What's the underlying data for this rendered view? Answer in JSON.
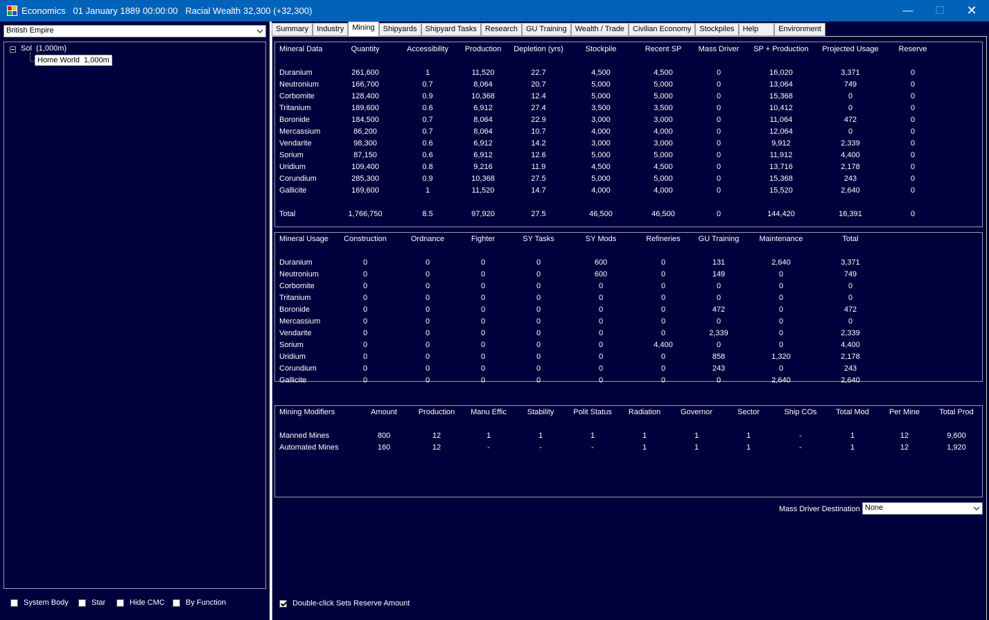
{
  "window": {
    "title": "Economics   01 January 1889 00:00:00   Racial Wealth 32,300 (+32,300)"
  },
  "sidebar": {
    "empire_select": "British Empire",
    "tree": {
      "root": "Sol  (1,000m)",
      "child": "Home World  1,000m"
    },
    "checkboxes": [
      {
        "label": "System Body",
        "checked": false
      },
      {
        "label": "Star",
        "checked": false
      },
      {
        "label": "Hide CMC",
        "checked": false
      },
      {
        "label": "By Function",
        "checked": false
      }
    ]
  },
  "tabs": [
    "Summary",
    "Industry",
    "Mining",
    "Shipyards",
    "Shipyard Tasks",
    "Research",
    "GU Training",
    "Wealth / Trade",
    "Civilian Economy",
    "Stockpiles",
    "Help",
    "Environment"
  ],
  "active_tab": "Mining",
  "mineral_data": {
    "headers": [
      "Mineral Data",
      "Quantity",
      "Accessibility",
      "Production",
      "Depletion (yrs)",
      "Stockpile",
      "Recent SP",
      "Mass Driver",
      "SP + Production",
      "Projected Usage",
      "Reserve"
    ],
    "rows": [
      [
        "Duranium",
        "261,600",
        "1",
        "11,520",
        "22.7",
        "4,500",
        "4,500",
        "0",
        "16,020",
        "3,371",
        "0"
      ],
      [
        "Neutronium",
        "166,700",
        "0.7",
        "8,064",
        "20.7",
        "5,000",
        "5,000",
        "0",
        "13,064",
        "749",
        "0"
      ],
      [
        "Corbomite",
        "128,400",
        "0.9",
        "10,368",
        "12.4",
        "5,000",
        "5,000",
        "0",
        "15,368",
        "0",
        "0"
      ],
      [
        "Tritanium",
        "189,600",
        "0.6",
        "6,912",
        "27.4",
        "3,500",
        "3,500",
        "0",
        "10,412",
        "0",
        "0"
      ],
      [
        "Boronide",
        "184,500",
        "0.7",
        "8,064",
        "22.9",
        "3,000",
        "3,000",
        "0",
        "11,064",
        "472",
        "0"
      ],
      [
        "Mercassium",
        "86,200",
        "0.7",
        "8,064",
        "10.7",
        "4,000",
        "4,000",
        "0",
        "12,064",
        "0",
        "0"
      ],
      [
        "Vendarite",
        "98,300",
        "0.6",
        "6,912",
        "14.2",
        "3,000",
        "3,000",
        "0",
        "9,912",
        "2,339",
        "0"
      ],
      [
        "Sorium",
        "87,150",
        "0.6",
        "6,912",
        "12.6",
        "5,000",
        "5,000",
        "0",
        "11,912",
        "4,400",
        "0"
      ],
      [
        "Uridium",
        "109,400",
        "0.8",
        "9,216",
        "11.9",
        "4,500",
        "4,500",
        "0",
        "13,716",
        "2,178",
        "0"
      ],
      [
        "Corundium",
        "285,300",
        "0.9",
        "10,368",
        "27.5",
        "5,000",
        "5,000",
        "0",
        "15,368",
        "243",
        "0"
      ],
      [
        "Gallicite",
        "169,600",
        "1",
        "11,520",
        "14.7",
        "4,000",
        "4,000",
        "0",
        "15,520",
        "2,640",
        "0"
      ]
    ],
    "total": [
      "Total",
      "1,766,750",
      "8.5",
      "97,920",
      "27.5",
      "46,500",
      "46,500",
      "0",
      "144,420",
      "16,391",
      "0"
    ]
  },
  "mineral_usage": {
    "headers": [
      "Mineral Usage",
      "Construction",
      "Ordnance",
      "Fighter",
      "SY Tasks",
      "SY Mods",
      "Refineries",
      "GU Training",
      "Maintenance",
      "Total"
    ],
    "rows": [
      [
        "Duranium",
        "0",
        "0",
        "0",
        "0",
        "600",
        "0",
        "131",
        "2,640",
        "3,371"
      ],
      [
        "Neutronium",
        "0",
        "0",
        "0",
        "0",
        "600",
        "0",
        "149",
        "0",
        "749"
      ],
      [
        "Corbomite",
        "0",
        "0",
        "0",
        "0",
        "0",
        "0",
        "0",
        "0",
        "0"
      ],
      [
        "Tritanium",
        "0",
        "0",
        "0",
        "0",
        "0",
        "0",
        "0",
        "0",
        "0"
      ],
      [
        "Boronide",
        "0",
        "0",
        "0",
        "0",
        "0",
        "0",
        "472",
        "0",
        "472"
      ],
      [
        "Mercassium",
        "0",
        "0",
        "0",
        "0",
        "0",
        "0",
        "0",
        "0",
        "0"
      ],
      [
        "Vendarite",
        "0",
        "0",
        "0",
        "0",
        "0",
        "0",
        "2,339",
        "0",
        "2,339"
      ],
      [
        "Sorium",
        "0",
        "0",
        "0",
        "0",
        "0",
        "4,400",
        "0",
        "0",
        "4,400"
      ],
      [
        "Uridium",
        "0",
        "0",
        "0",
        "0",
        "0",
        "0",
        "858",
        "1,320",
        "2,178"
      ],
      [
        "Corundium",
        "0",
        "0",
        "0",
        "0",
        "0",
        "0",
        "243",
        "0",
        "243"
      ],
      [
        "Gallicite",
        "0",
        "0",
        "0",
        "0",
        "0",
        "0",
        "0",
        "2,640",
        "2,640"
      ]
    ]
  },
  "mining_modifiers": {
    "headers": [
      "Mining Modifiers",
      "Amount",
      "Production",
      "Manu Effic",
      "Stability",
      "Polit Status",
      "Radiation",
      "Governor",
      "Sector",
      "Ship COs",
      "Total Mod",
      "Per Mine",
      "Total Prod"
    ],
    "rows": [
      [
        "Manned Mines",
        "800",
        "12",
        "1",
        "1",
        "1",
        "1",
        "1",
        "1",
        "-",
        "1",
        "12",
        "9,600"
      ],
      [
        "Automated Mines",
        "160",
        "12",
        "-",
        "-",
        "-",
        "1",
        "1",
        "1",
        "-",
        "1",
        "12",
        "1,920"
      ]
    ]
  },
  "mass_driver": {
    "label": "Mass Driver Destination",
    "value": "None"
  },
  "double_click": {
    "label": "Double-click Sets Reserve Amount",
    "checked": true
  }
}
